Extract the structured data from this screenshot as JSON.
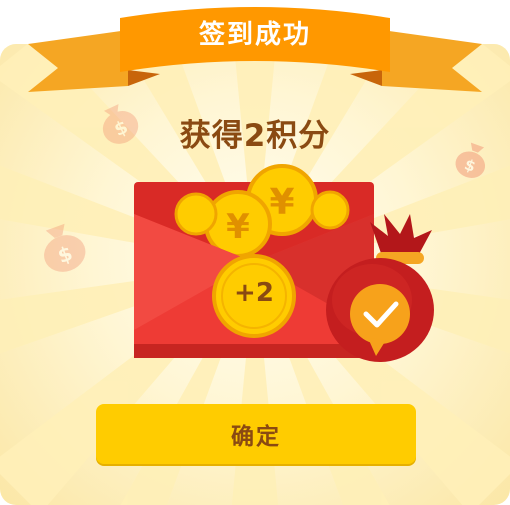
{
  "dialog": {
    "ribbon_title": "签到成功",
    "headline": "获得2积分",
    "coin_label": "+2",
    "confirm_label": "确定"
  },
  "colors": {
    "ribbon": "#ff9800",
    "envelope": "#e8332f",
    "coin": "#ffcc00",
    "button": "#ffcc00",
    "text_brown": "#8a4a12"
  },
  "icons": [
    "money-bag-icon",
    "coin-icon",
    "checkmark-icon"
  ]
}
